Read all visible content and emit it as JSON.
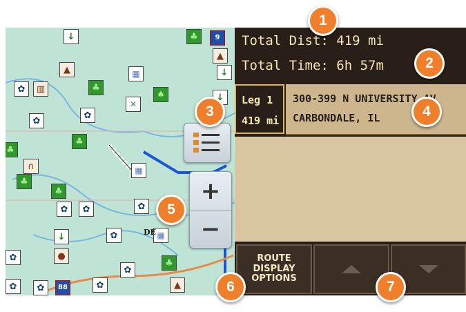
{
  "trip": {
    "total_distance": "Total Dist: 419 mi",
    "total_time": "Total Time: 6h 57m"
  },
  "leg": {
    "label": "Leg 1",
    "distance": "419 mi",
    "address_line1": "300-399 N UNIVERSITY AV",
    "address_line2": "CARBONDALE, IL"
  },
  "buttons": {
    "route_display_line1": "ROUTE",
    "route_display_line2": "DISPLAY",
    "route_display_line3": "OPTIONS",
    "zoom_in": "+",
    "zoom_out": "−"
  },
  "map": {
    "city_label": "DE",
    "interstate_1": "88",
    "interstate_2": "9"
  },
  "callouts": [
    "1",
    "2",
    "3",
    "4",
    "5",
    "6",
    "7"
  ],
  "colors": {
    "callout": "#ef7f2b",
    "panel_dark": "#2a1f18",
    "panel_tan": "#d8c6a1",
    "text_cream": "#f3e6b3",
    "route_blue": "#1a55d6"
  },
  "icons": [
    "paw-icon",
    "forest-icon",
    "tent-icon",
    "arrow-down-icon",
    "city-icon",
    "list-icon"
  ]
}
